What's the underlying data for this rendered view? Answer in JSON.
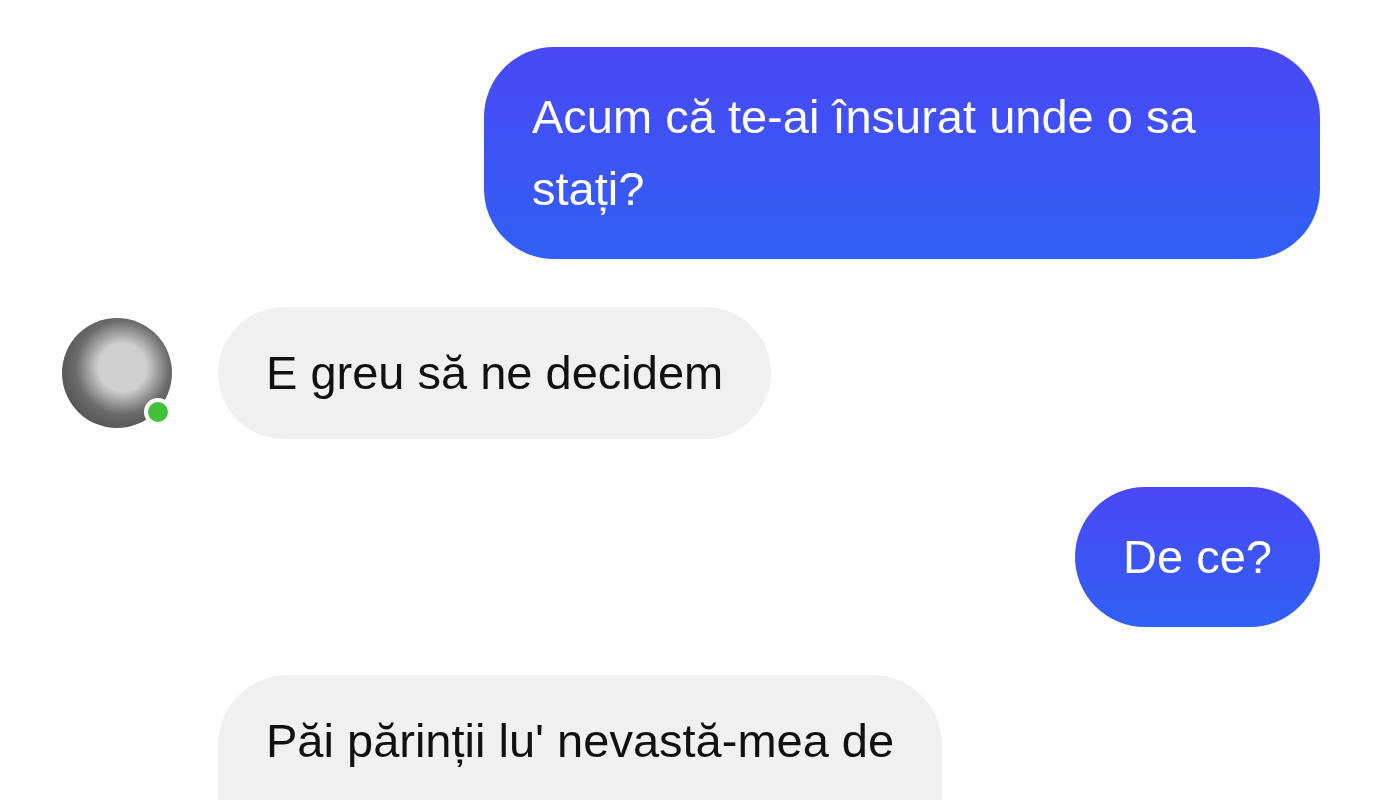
{
  "messages": [
    {
      "kind": "sent",
      "text": "Acum că te-ai însurat unde o sa stați?"
    },
    {
      "kind": "received",
      "text": "E greu să ne decidem",
      "avatar": true,
      "online": true
    },
    {
      "kind": "sent",
      "text": "De ce?"
    },
    {
      "kind": "received",
      "text": "Păi părinții lu' nevastă-mea de",
      "avatar": false,
      "online": false
    }
  ]
}
